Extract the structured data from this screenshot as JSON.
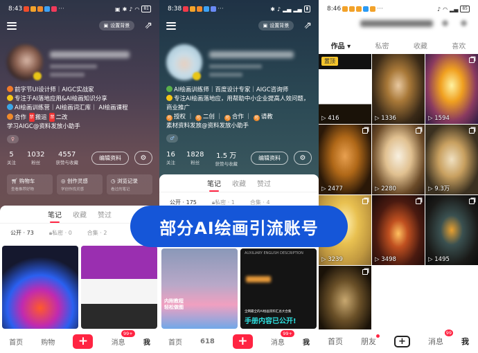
{
  "banner": {
    "text": "部分AI绘画引流账号",
    "color": "#1556d8"
  },
  "phone1": {
    "status": {
      "time": "8:43",
      "battery": "81"
    },
    "set_background": "设置背景",
    "bio": [
      "前字节UI设计师｜AIGC实战家",
      "专注于AI落地应用&AI绘画知识分享",
      "AI绘画训练营｜AI绘画词汇库｜ AI绘画课程"
    ],
    "bio_tags": {
      "prefix": "合作",
      "tag1": "搬运",
      "tag2": "二改",
      "forbidden": "禁"
    },
    "bio_footer": "学习AIGC@资料发放小助手",
    "stats": [
      {
        "value": "5",
        "label": "关注"
      },
      {
        "value": "1032",
        "label": "粉丝"
      },
      {
        "value": "4557",
        "label": "获赞与收藏"
      }
    ],
    "edit_profile": "编辑资料",
    "quick": [
      {
        "title": "购物车",
        "sub": "查看推荐好物"
      },
      {
        "title": "创作灵感",
        "sub": "学创作找灵感"
      },
      {
        "title": "浏览记录",
        "sub": "看过的笔记"
      }
    ],
    "tabs": [
      "笔记",
      "收藏",
      "赞过"
    ],
    "subtabs": [
      "公开 · 73",
      "私密 · 0",
      "合集 · 2"
    ],
    "nav": {
      "home": "首页",
      "second": "购物",
      "messages": "消息",
      "badge": "99+",
      "me": "我"
    }
  },
  "phone2": {
    "status": {
      "time": "8:38"
    },
    "set_background": "设置背景",
    "bio": [
      "AI绘画训练师｜百度设计专家｜AIGC咨询师",
      "专注AI绘画落地应，用帮助中小企业提高人效问题，商业推广"
    ],
    "bio_tags": [
      "授权",
      "二创",
      "合作",
      "请教"
    ],
    "bio_tag_prefix": "可",
    "bio_footer": "素材资料发放@资料发放小助手",
    "stats": [
      {
        "value": "16",
        "label": "关注"
      },
      {
        "value": "1828",
        "label": "粉丝"
      },
      {
        "value": "1.5 万",
        "label": "获赞与收藏"
      }
    ],
    "edit_profile": "编辑资料",
    "tabs": [
      "笔记",
      "收藏",
      "赞过"
    ],
    "subtabs": [
      "公开 · 175",
      "私密 · 1",
      "合集 · 4"
    ],
    "card1_caption": "内附教程 轻松做图",
    "card2_header": "AUXILIARY ENGLISH DESCRIPTION",
    "card2_small": "全网最全的AI绘画资料汇总大合集",
    "card2_title": "手册内容已公开!",
    "nav": {
      "home": "首页",
      "second": "618",
      "messages": "消息",
      "badge": "99+",
      "me": "我"
    }
  },
  "phone3": {
    "status": {
      "time": "8:46",
      "battery": "85"
    },
    "tabs": [
      "作品 ▾",
      "私密",
      "收藏",
      "喜欢"
    ],
    "pinned_label": "置顶",
    "videos": [
      {
        "plays": "416",
        "pinned": true
      },
      {
        "plays": "1336"
      },
      {
        "plays": "1594"
      },
      {
        "plays": "2477"
      },
      {
        "plays": "2280"
      },
      {
        "plays": "9.3万"
      },
      {
        "plays": "3239"
      },
      {
        "plays": "3498"
      },
      {
        "plays": "1495"
      },
      {
        "plays": ""
      }
    ],
    "nav": {
      "home": "首页",
      "friends": "朋友",
      "messages": "消息",
      "badge": "99",
      "me": "我"
    }
  }
}
